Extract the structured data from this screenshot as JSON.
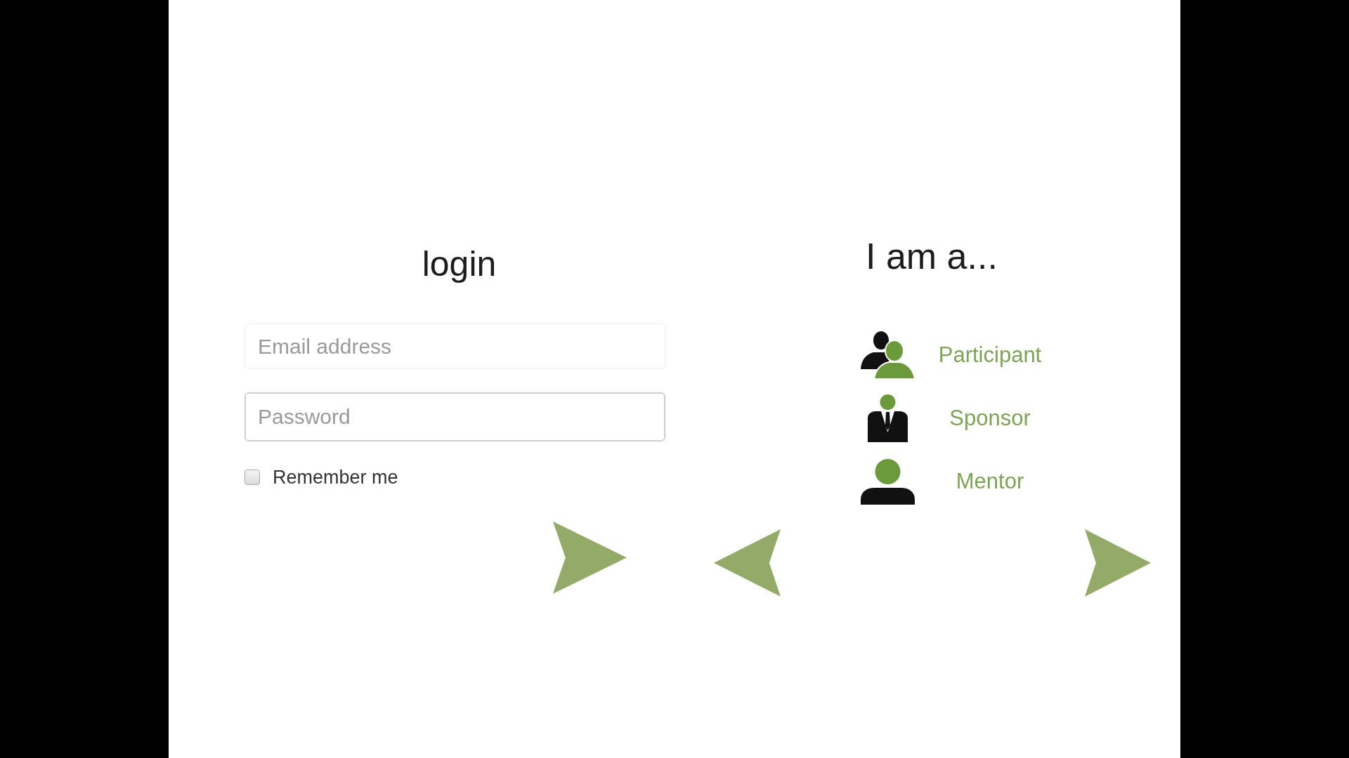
{
  "login": {
    "title": "login",
    "email": {
      "placeholder": "Email address"
    },
    "password": {
      "placeholder": "Password"
    },
    "remember": {
      "label": "Remember me",
      "checked": false
    }
  },
  "roles": {
    "title": "I am a...",
    "items": [
      {
        "label": "Participant",
        "kind": "participant"
      },
      {
        "label": "Sponsor",
        "kind": "sponsor"
      },
      {
        "label": "Mentor",
        "kind": "mentor"
      }
    ]
  }
}
